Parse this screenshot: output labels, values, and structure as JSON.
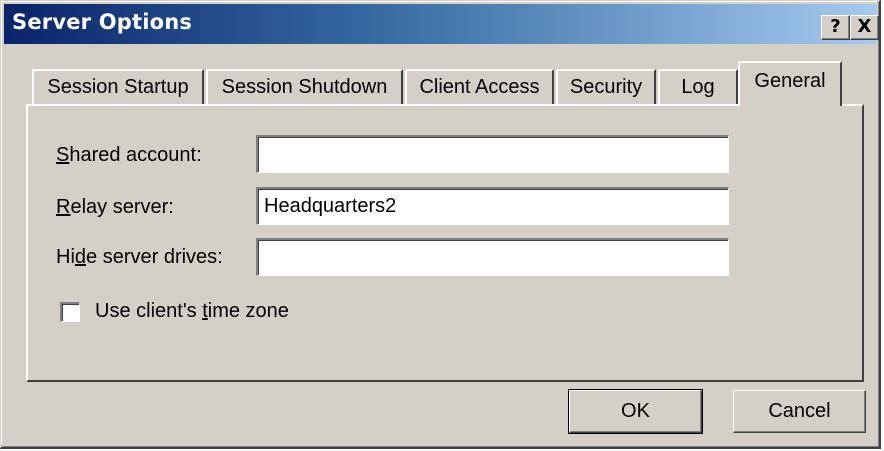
{
  "window": {
    "title": "Server Options",
    "help_button": "?",
    "close_button": "X"
  },
  "tabs": [
    {
      "label": "Session Startup",
      "active": false
    },
    {
      "label": "Session Shutdown",
      "active": false
    },
    {
      "label": "Client Access",
      "active": false
    },
    {
      "label": "Security",
      "active": false
    },
    {
      "label": "Log",
      "active": false
    },
    {
      "label": "General",
      "active": true
    }
  ],
  "form": {
    "shared_account": {
      "mnemonic": "S",
      "label_rest": "hared account:",
      "value": ""
    },
    "relay_server": {
      "mnemonic": "R",
      "label_rest": "elay server:",
      "value": "Headquarters2"
    },
    "hide_server_drives": {
      "label_pre": "Hi",
      "mnemonic": "d",
      "label_rest": "e server drives:",
      "value": ""
    },
    "use_client_time_zone": {
      "label_pre": "Use client's ",
      "mnemonic": "t",
      "label_rest": "ime zone",
      "checked": false
    }
  },
  "buttons": {
    "ok": "OK",
    "cancel": "Cancel"
  },
  "colors": {
    "face": "#d4d0c8",
    "title_start": "#0a246a",
    "title_end": "#a6caf0"
  }
}
